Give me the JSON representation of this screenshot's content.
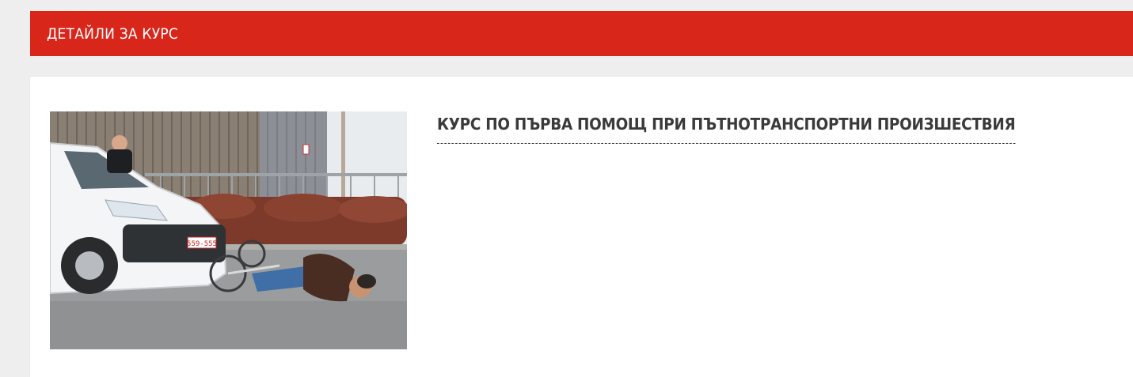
{
  "header": {
    "title": "ДЕТАЙЛИ ЗА КУРС"
  },
  "course": {
    "title": "КУРС ПО ПЪРВА ПОМОЩ ПРИ ПЪТНОТРАНСПОРТНИ ПРОИЗШЕСТВИЯ",
    "image_alt": "cyclist-accident-photo",
    "plate_text": "559-555"
  },
  "colors": {
    "accent": "#d8261b",
    "background": "#eeeeee",
    "card": "#ffffff",
    "title_text": "#3a3a3a"
  }
}
